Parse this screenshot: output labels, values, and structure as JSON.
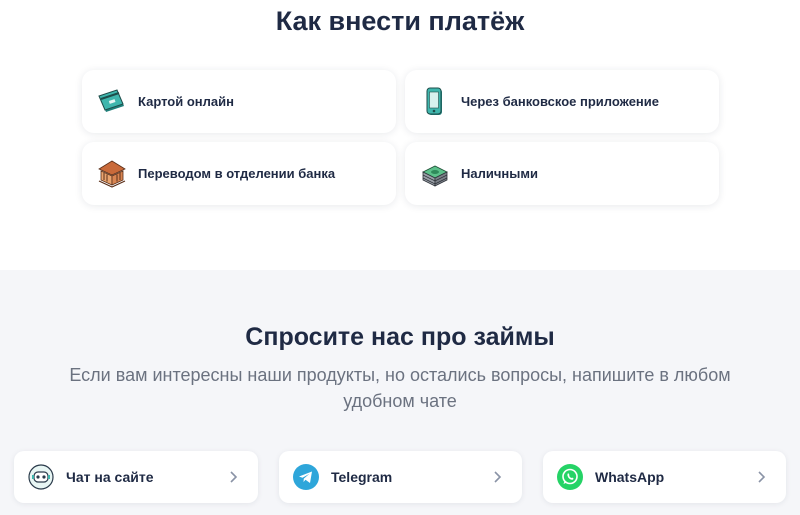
{
  "payment": {
    "title": "Как внести платёж",
    "methods": [
      {
        "label": "Картой онлайн",
        "icon": "card-icon"
      },
      {
        "label": "Через банковское приложение",
        "icon": "phone-icon"
      },
      {
        "label": "Переводом в отделении банка",
        "icon": "bank-icon"
      },
      {
        "label": "Наличными",
        "icon": "cash-icon"
      }
    ]
  },
  "ask": {
    "title": "Спросите нас про займы",
    "subtitle": "Если вам интересны наши продукты, но остались вопросы, напишите в любом удобном чате",
    "chats": [
      {
        "label": "Чат на сайте",
        "icon": "robot-icon"
      },
      {
        "label": "Telegram",
        "icon": "telegram-icon",
        "color": "#2ea6da"
      },
      {
        "label": "WhatsApp",
        "icon": "whatsapp-icon",
        "color": "#25d366"
      }
    ]
  },
  "colors": {
    "text": "#1f2a44",
    "muted": "#6b7280",
    "section_bg": "#f5f6f9"
  }
}
